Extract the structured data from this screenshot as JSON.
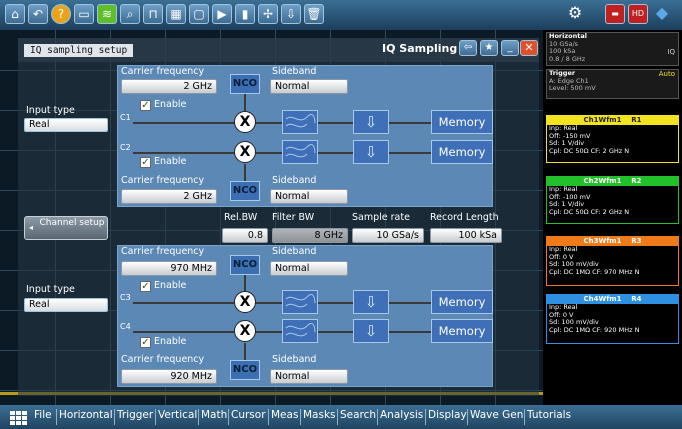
{
  "toolbar": {
    "icons": [
      "home-icon",
      "undo-icon",
      "help-icon",
      "screen-icon",
      "autoset-icon",
      "zoom-icon",
      "measure-icon",
      "histogram-icon",
      "mask-icon",
      "play-icon",
      "record-icon",
      "cursor-icon",
      "save-icon",
      "delete-icon",
      "settings-icon",
      "flag-icon",
      "hd-icon",
      "connect-icon"
    ]
  },
  "dialog": {
    "tab_label": "IQ sampling setup",
    "title": "IQ Sampling",
    "upper": {
      "input_type_label": "Input type",
      "input_type_value": "Real",
      "carrier1_label": "Carrier frequency",
      "carrier1_value": "2 GHz",
      "carrier2_label": "Carrier frequency",
      "carrier2_value": "2 GHz",
      "sideband1_label": "Sideband",
      "sideband1_value": "Normal",
      "sideband2_label": "Sideband",
      "sideband2_value": "Normal",
      "enable1": "Enable",
      "enable2": "Enable",
      "c1": "C1",
      "c2": "C2"
    },
    "middle": {
      "channel_setup_label": "Channel setup",
      "rel_bw_label": "Rel.BW",
      "rel_bw_value": "0.8",
      "filter_bw_label": "Filter BW",
      "filter_bw_value": "8 GHz",
      "sample_rate_label": "Sample rate",
      "sample_rate_value": "10 GSa/s",
      "record_length_label": "Record Length",
      "record_length_value": "100 kSa"
    },
    "lower": {
      "input_type_label": "Input type",
      "input_type_value": "Real",
      "carrier1_label": "Carrier frequency",
      "carrier1_value": "970 MHz",
      "carrier2_label": "Carrier frequency",
      "carrier2_value": "920 MHz",
      "sideband1_label": "Sideband",
      "sideband1_value": "Normal",
      "sideband2_label": "Sideband",
      "sideband2_value": "Normal",
      "enable1": "Enable",
      "enable2": "Enable",
      "c3": "C3",
      "c4": "C4"
    },
    "nco": "NCO",
    "mixer": "X",
    "memory": "Memory"
  },
  "side": {
    "horizontal": {
      "title": "Horizontal",
      "lines": [
        "10 GSa/s",
        "100 kSa",
        "0.8 / 8 GHz"
      ],
      "tag": "IQ"
    },
    "trigger": {
      "title": "Trigger",
      "mode": "Auto",
      "lines": [
        "A:   Edge  Ch1",
        "Level: 500 mV"
      ]
    },
    "cards": [
      {
        "title": "Ch1Wfm1",
        "tag": "R1",
        "color": "#f2e320",
        "lines": [
          "Inp: Real",
          "Off: -150 mV",
          "Sd: 1 V/div",
          "Cpl: DC 50Ω     CF: 2 GHz N"
        ]
      },
      {
        "title": "Ch2Wfm1",
        "tag": "R2",
        "color": "#22c02a",
        "lines": [
          "Inp: Real",
          "Off: -100 mV",
          "Sd: 1 V/div",
          "Cpl: DC 50Ω     CF: 2 GHz N"
        ]
      },
      {
        "title": "Ch3Wfm1",
        "tag": "R3",
        "color": "#ee7a1a",
        "lines": [
          "Inp: Real",
          "Off: 0 V",
          "Sd: 100 mV/div",
          "Cpl: DC 1MΩ    CF: 970 MHz N"
        ]
      },
      {
        "title": "Ch4Wfm1",
        "tag": "R4",
        "color": "#2f8fe0",
        "lines": [
          "Inp: Real",
          "Off: 0 V",
          "Sd: 100 mV/div",
          "Cpl: DC 1MΩ    CF: 920 MHz N"
        ]
      }
    ]
  },
  "menu": {
    "items": [
      "File",
      "Horizontal",
      "Trigger",
      "Vertical",
      "Math",
      "Cursor",
      "Meas",
      "Masks",
      "Search",
      "Analysis",
      "Display",
      "Wave Gen",
      "Tutorials"
    ]
  },
  "colors": {
    "toolbar": "#2b5a7d",
    "panel": "#5b88b5",
    "block": "#3f6fb7"
  }
}
